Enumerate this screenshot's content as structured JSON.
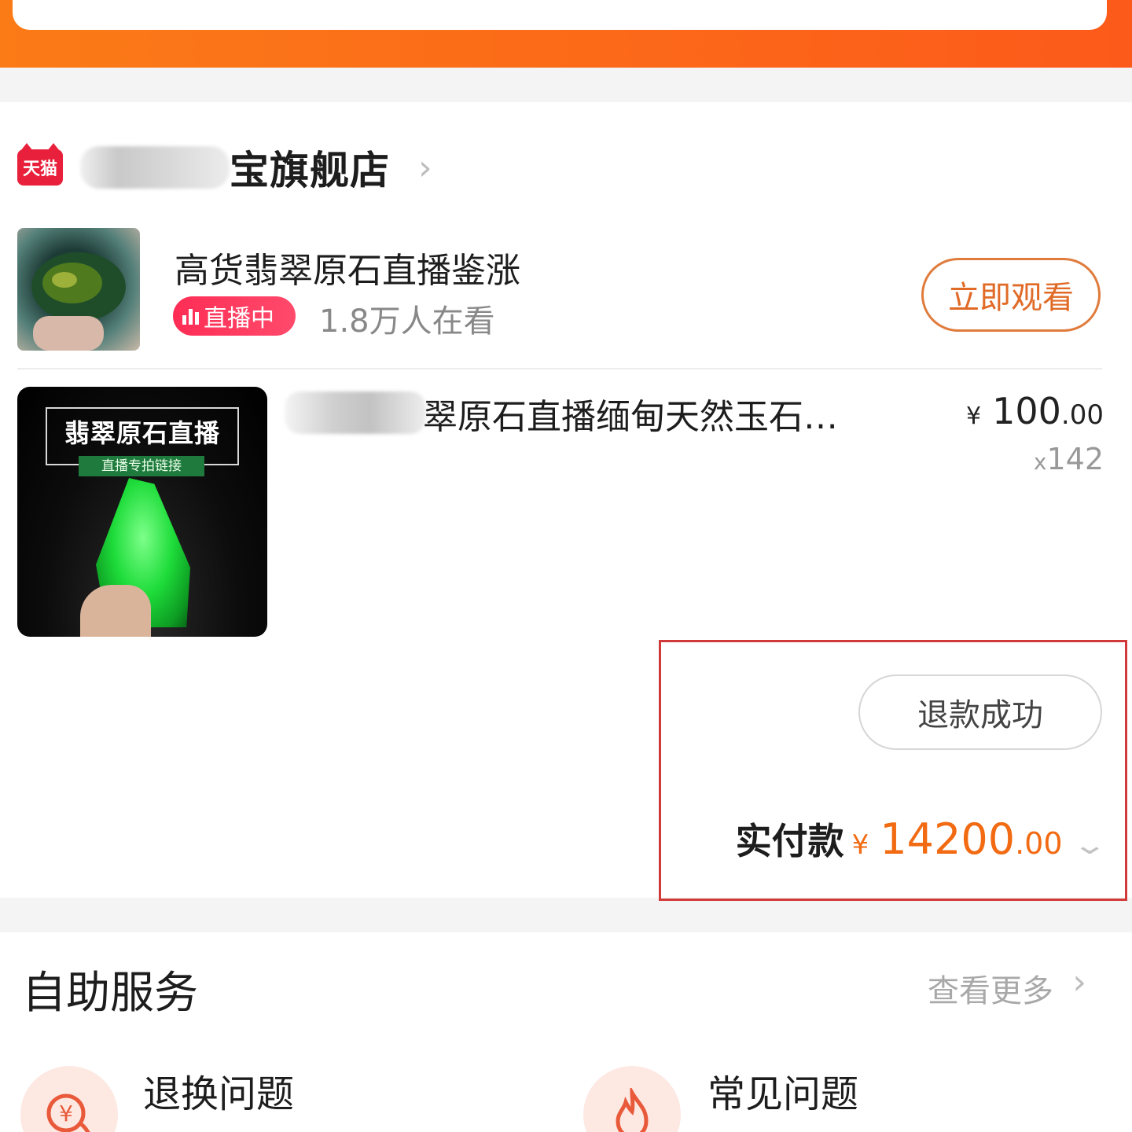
{
  "shop": {
    "platform_badge": "天猫",
    "name_visible": "宝旗舰店"
  },
  "live": {
    "title": "高货翡翠原石直播鉴涨",
    "badge": "直播中",
    "viewers": "1.8万人在看",
    "watch_button": "立即观看"
  },
  "product": {
    "thumb_title": "翡翠原石直播",
    "thumb_subtitle": "直播专拍链接",
    "title_visible": "翠原石直播缅甸天然玉石…",
    "price_currency": "¥",
    "price_integer": "100",
    "price_cents": ".00",
    "qty_prefix": "x",
    "qty": "142"
  },
  "refund": {
    "button": "退款成功",
    "paid_label": "实付款",
    "paid_currency": "¥",
    "paid_integer": "14200",
    "paid_cents": ".00"
  },
  "service": {
    "title": "自助服务",
    "more": "查看更多",
    "items": [
      {
        "label": "退换问题",
        "icon": "refund-yen-icon"
      },
      {
        "label": "常见问题",
        "icon": "fire-icon"
      }
    ]
  },
  "colors": {
    "accent_orange": "#f26a12",
    "header_orange": "#fb7b17",
    "live_pink": "#ff2d55",
    "tmall_red": "#e8203b",
    "highlight_red": "#d23a3a"
  }
}
